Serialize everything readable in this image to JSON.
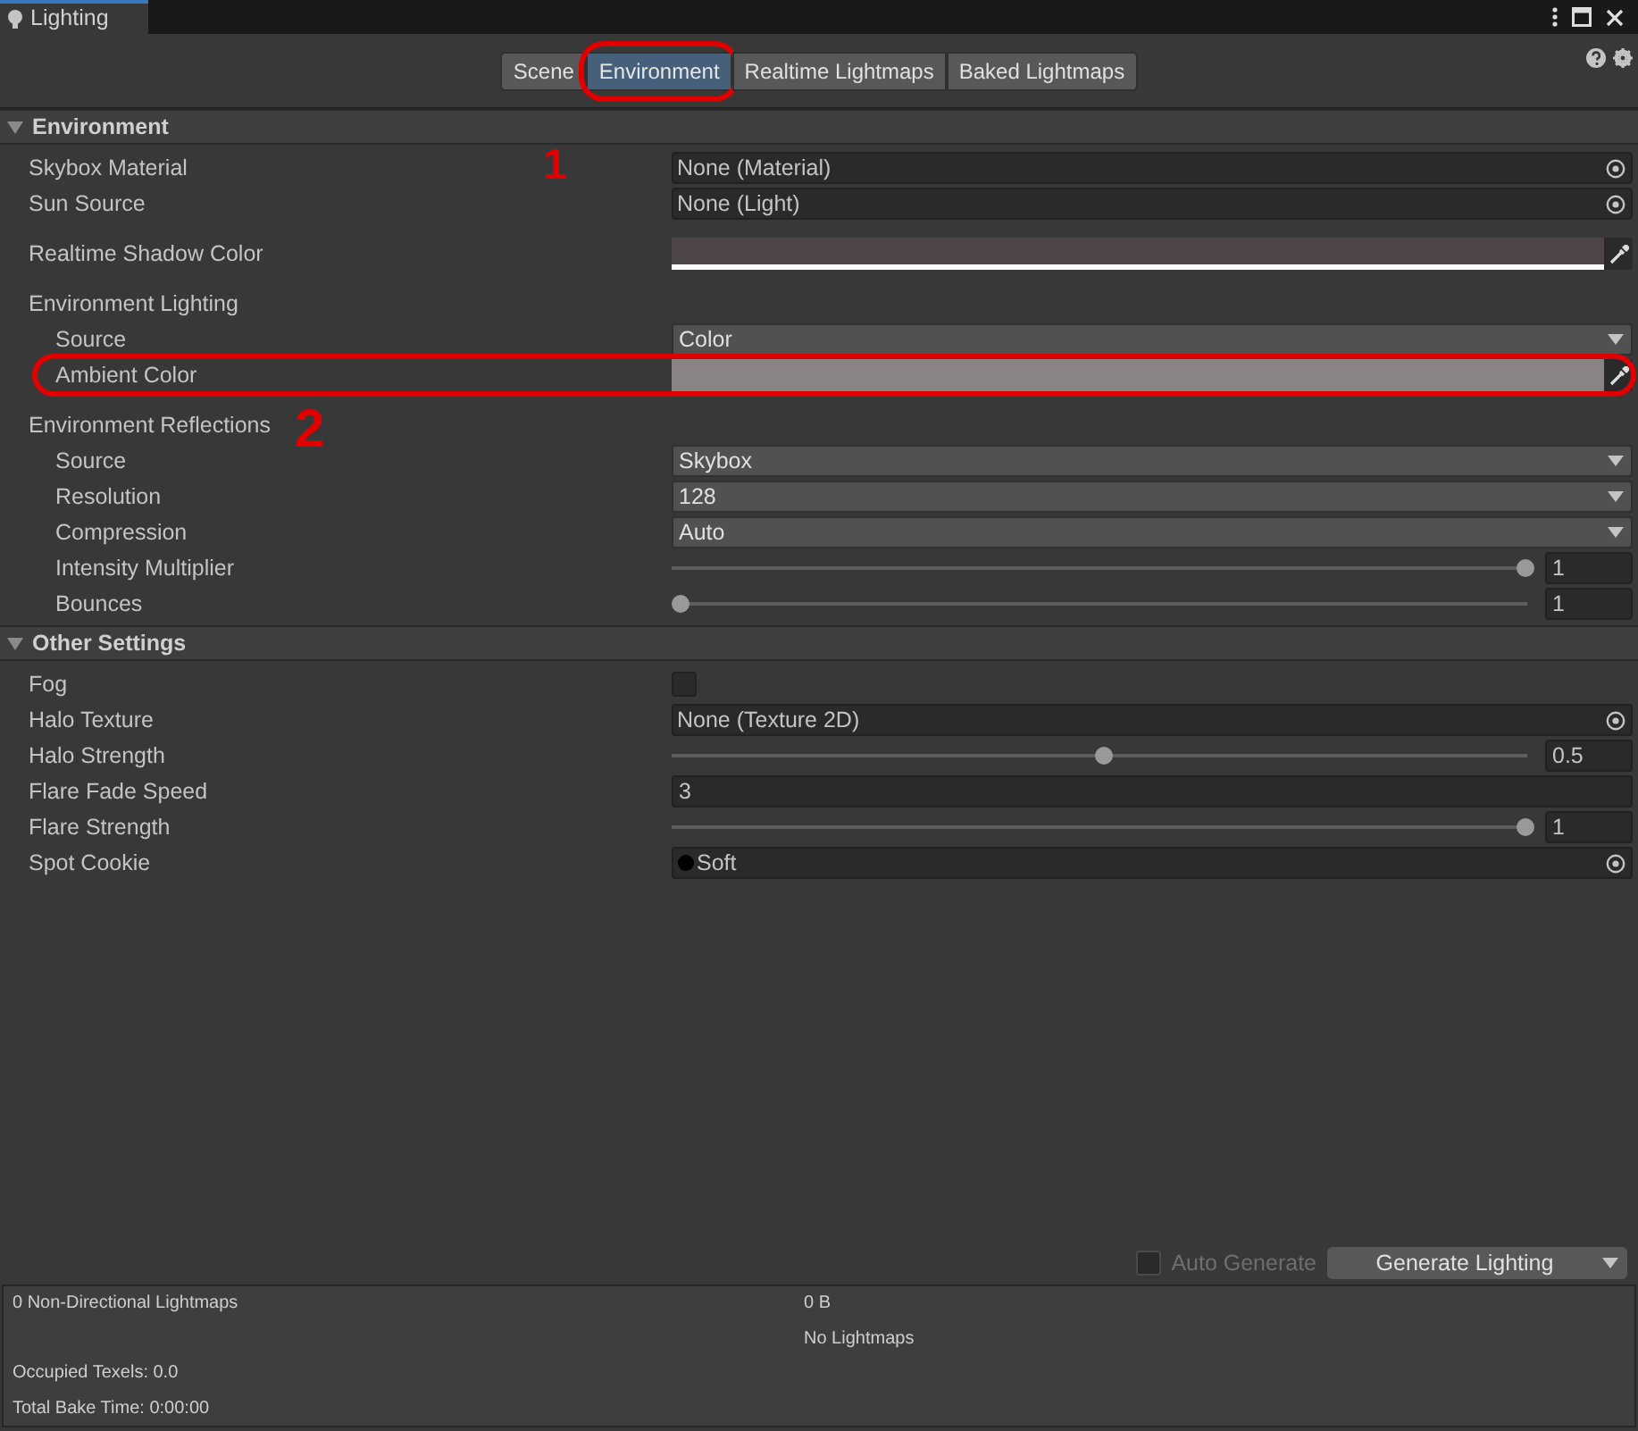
{
  "window": {
    "title": "Lighting"
  },
  "tabs": [
    {
      "label": "Scene",
      "selected": false
    },
    {
      "label": "Environment",
      "selected": true
    },
    {
      "label": "Realtime Lightmaps",
      "selected": false
    },
    {
      "label": "Baked Lightmaps",
      "selected": false
    }
  ],
  "sections": [
    {
      "title": "Environment",
      "expanded": true,
      "rows": [
        {
          "kind": "object",
          "label": "Skybox Material",
          "value": "None (Material)"
        },
        {
          "kind": "object",
          "label": "Sun Source",
          "value": "None (Light)"
        },
        {
          "kind": "color_alpha",
          "label": "Realtime Shadow Color",
          "color": "#4e4546"
        },
        {
          "kind": "group",
          "label": "Environment Lighting",
          "children": [
            {
              "kind": "dropdown",
              "label": "Source",
              "value": "Color"
            },
            {
              "kind": "color",
              "label": "Ambient Color",
              "color": "#8a8383"
            }
          ]
        },
        {
          "kind": "group",
          "label": "Environment Reflections",
          "children": [
            {
              "kind": "dropdown",
              "label": "Source",
              "value": "Skybox"
            },
            {
              "kind": "dropdown",
              "label": "Resolution",
              "value": "128"
            },
            {
              "kind": "dropdown",
              "label": "Compression",
              "value": "Auto"
            },
            {
              "kind": "slider",
              "label": "Intensity Multiplier",
              "level": 1,
              "value": "1"
            },
            {
              "kind": "slider",
              "label": "Bounces",
              "level": 0,
              "value": "1"
            }
          ]
        }
      ]
    },
    {
      "title": "Other Settings",
      "expanded": true,
      "rows": [
        {
          "kind": "checkbox",
          "label": "Fog",
          "checked": false
        },
        {
          "kind": "object",
          "label": "Halo Texture",
          "value": "None (Texture 2D)"
        },
        {
          "kind": "slider",
          "label": "Halo Strength",
          "level": 0.5,
          "value": "0.5"
        },
        {
          "kind": "number",
          "label": "Flare Fade Speed",
          "value": "3"
        },
        {
          "kind": "slider",
          "label": "Flare Strength",
          "level": 1,
          "value": "1"
        },
        {
          "kind": "object_dot",
          "label": "Spot Cookie",
          "value": "Soft"
        }
      ]
    }
  ],
  "footer": {
    "auto_generate": {
      "label": "Auto Generate",
      "checked": false,
      "disabled": true
    },
    "generate_button": "Generate Lighting"
  },
  "stats": {
    "lightmaps": "0 Non-Directional Lightmaps",
    "size": "0 B",
    "note": "No Lightmaps",
    "texels": "Occupied Texels: 0.0",
    "bake_time": "Total Bake Time: 0:00:00"
  },
  "annotations": [
    {
      "label": "1"
    },
    {
      "label": "2"
    }
  ]
}
